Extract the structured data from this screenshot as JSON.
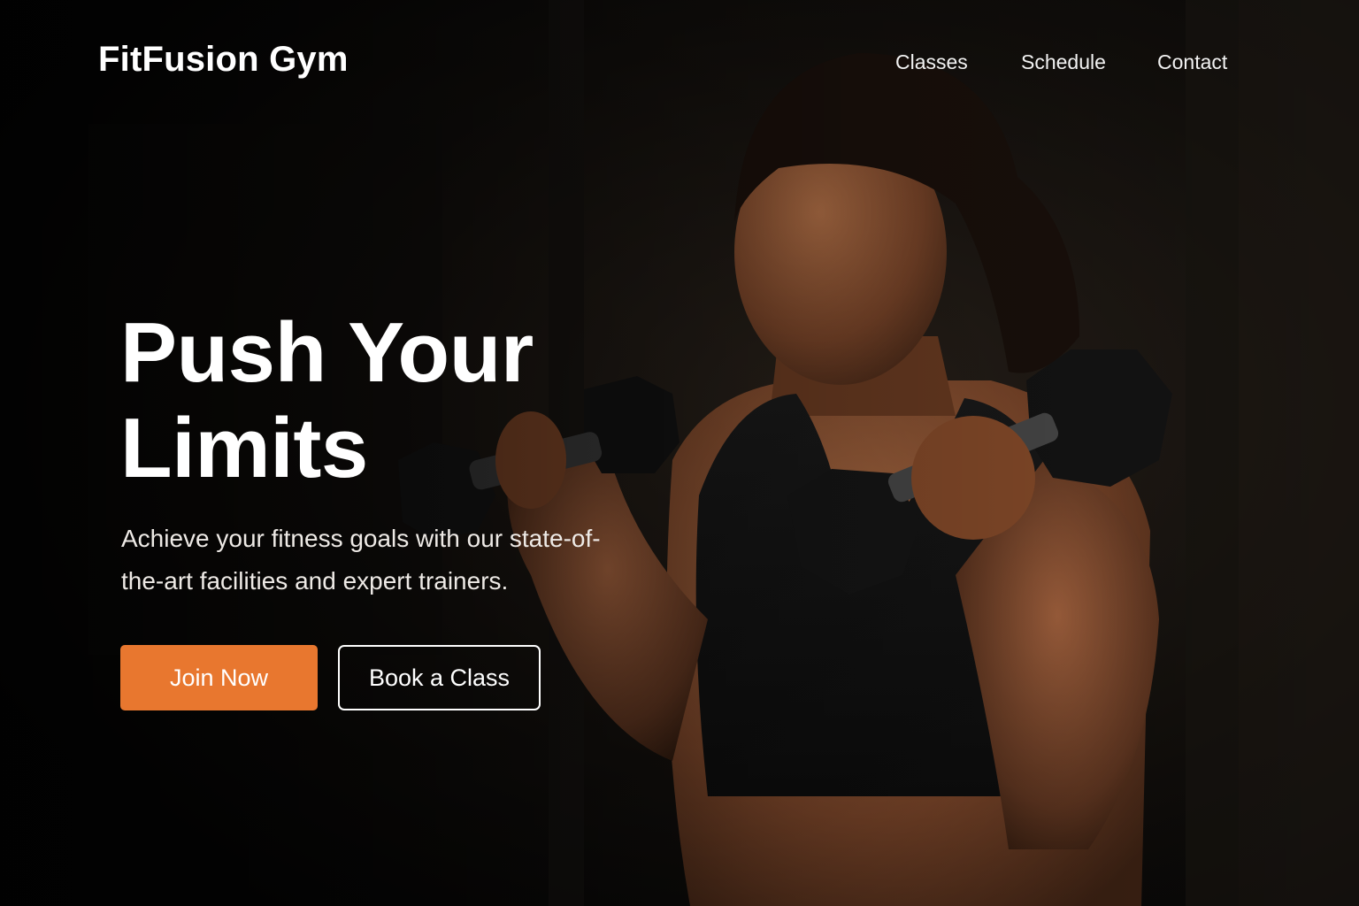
{
  "brand": {
    "name": "FitFusion Gym"
  },
  "nav": {
    "items": [
      "Classes",
      "Schedule",
      "Contact"
    ]
  },
  "hero": {
    "headline_line1": "Push Your",
    "headline_line2": "Limits",
    "subtext": "Achieve your fitness goals with our state-of-the-art facilities and expert trainers.",
    "primary_cta": "Join Now",
    "secondary_cta": "Book a Class",
    "image_subject": "woman lifting dumbbells in dark gym"
  },
  "colors": {
    "accent": "#e8772f",
    "background": "#0b0a09",
    "text": "#ffffff"
  }
}
